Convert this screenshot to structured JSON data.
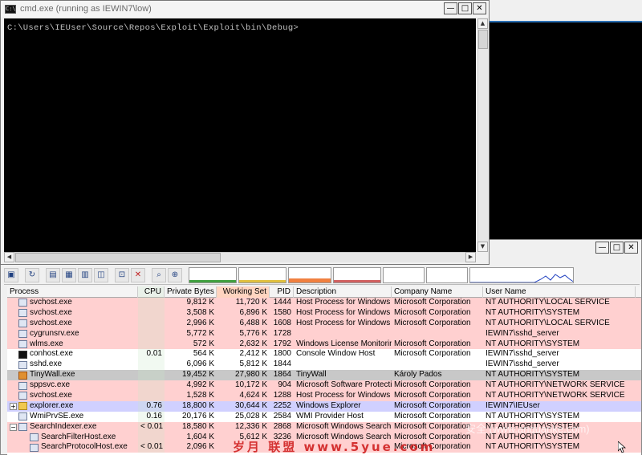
{
  "cmd": {
    "title": "cmd.exe (running as IEWIN7\\low)",
    "icon": "C:\\",
    "prompt_line": "C:\\Users\\IEUser\\Source\\Repos\\Exploit\\Exploit\\bin\\Debug>"
  },
  "window_buttons": {
    "minimize": "—",
    "maximize": "□",
    "close": "✕"
  },
  "procexp": {
    "columns": {
      "process": "Process",
      "cpu": "CPU",
      "private_bytes": "Private Bytes",
      "working_set": "Working Set",
      "pid": "PID",
      "description": "Description",
      "company": "Company Name",
      "user": "User Name"
    },
    "rows": [
      {
        "name": "svchost.exe",
        "cpu": "",
        "pb": "9,812 K",
        "ws": "11,720 K",
        "pid": "1444",
        "desc": "Host Process for Windows S...",
        "comp": "Microsoft Corporation",
        "user": "NT AUTHORITY\\LOCAL SERVICE"
      },
      {
        "name": "svchost.exe",
        "cpu": "",
        "pb": "3,508 K",
        "ws": "6,896 K",
        "pid": "1580",
        "desc": "Host Process for Windows S...",
        "comp": "Microsoft Corporation",
        "user": "NT AUTHORITY\\SYSTEM"
      },
      {
        "name": "svchost.exe",
        "cpu": "",
        "pb": "2,996 K",
        "ws": "6,488 K",
        "pid": "1608",
        "desc": "Host Process for Windows S...",
        "comp": "Microsoft Corporation",
        "user": "NT AUTHORITY\\LOCAL SERVICE"
      },
      {
        "name": "cygrunsrv.exe",
        "cpu": "",
        "pb": "5,772 K",
        "ws": "5,776 K",
        "pid": "1728",
        "desc": "",
        "comp": "",
        "user": "IEWIN7\\sshd_server"
      },
      {
        "name": "wlms.exe",
        "cpu": "",
        "pb": "572 K",
        "ws": "2,632 K",
        "pid": "1792",
        "desc": "Windows License Monitoring...",
        "comp": "Microsoft Corporation",
        "user": "NT AUTHORITY\\SYSTEM"
      },
      {
        "name": "conhost.exe",
        "cpu": "0.01",
        "pb": "564 K",
        "ws": "2,412 K",
        "pid": "1800",
        "desc": "Console Window Host",
        "comp": "Microsoft Corporation",
        "user": "IEWIN7\\sshd_server"
      },
      {
        "name": "sshd.exe",
        "cpu": "",
        "pb": "6,096 K",
        "ws": "5,812 K",
        "pid": "1844",
        "desc": "",
        "comp": "",
        "user": "IEWIN7\\sshd_server"
      },
      {
        "name": "TinyWall.exe",
        "cpu": "",
        "pb": "19,452 K",
        "ws": "27,980 K",
        "pid": "1864",
        "desc": "TinyWall",
        "comp": "Károly Pados",
        "user": "NT AUTHORITY\\SYSTEM"
      },
      {
        "name": "sppsvc.exe",
        "cpu": "",
        "pb": "4,992 K",
        "ws": "10,172 K",
        "pid": "904",
        "desc": "Microsoft Software Protectio...",
        "comp": "Microsoft Corporation",
        "user": "NT AUTHORITY\\NETWORK SERVICE"
      },
      {
        "name": "svchost.exe",
        "cpu": "",
        "pb": "1,528 K",
        "ws": "4,624 K",
        "pid": "1288",
        "desc": "Host Process for Windows S...",
        "comp": "Microsoft Corporation",
        "user": "NT AUTHORITY\\NETWORK SERVICE"
      },
      {
        "name": "explorer.exe",
        "cpu": "0.76",
        "pb": "18,800 K",
        "ws": "30,644 K",
        "pid": "2252",
        "desc": "Windows Explorer",
        "comp": "Microsoft Corporation",
        "user": "IEWIN7\\IEUser"
      },
      {
        "name": "WmiPrvSE.exe",
        "cpu": "0.16",
        "pb": "20,176 K",
        "ws": "25,028 K",
        "pid": "2584",
        "desc": "WMI Provider Host",
        "comp": "Microsoft Corporation",
        "user": "NT AUTHORITY\\SYSTEM"
      },
      {
        "name": "SearchIndexer.exe",
        "cpu": "< 0.01",
        "pb": "18,580 K",
        "ws": "12,336 K",
        "pid": "2868",
        "desc": "Microsoft Windows Search I...",
        "comp": "Microsoft Corporation",
        "user": "NT AUTHORITY\\SYSTEM"
      },
      {
        "name": "SearchFilterHost.exe",
        "cpu": "",
        "pb": "1,604 K",
        "ws": "5,612 K",
        "pid": "3236",
        "desc": "Microsoft Windows Search F...",
        "comp": "Microsoft Corporation",
        "user": "NT AUTHORITY\\SYSTEM"
      },
      {
        "name": "SearchProtocolHost.exe",
        "cpu": "< 0.01",
        "pb": "2,096 K",
        "ws": "",
        "pid": "",
        "desc": "",
        "comp": "Microsoft Corporation",
        "user": "NT AUTHORITY\\SYSTEM"
      }
    ]
  },
  "watermark": "岁月 联盟 www.5yue.com",
  "watermark2": "安全 (www.anquanke.com)"
}
